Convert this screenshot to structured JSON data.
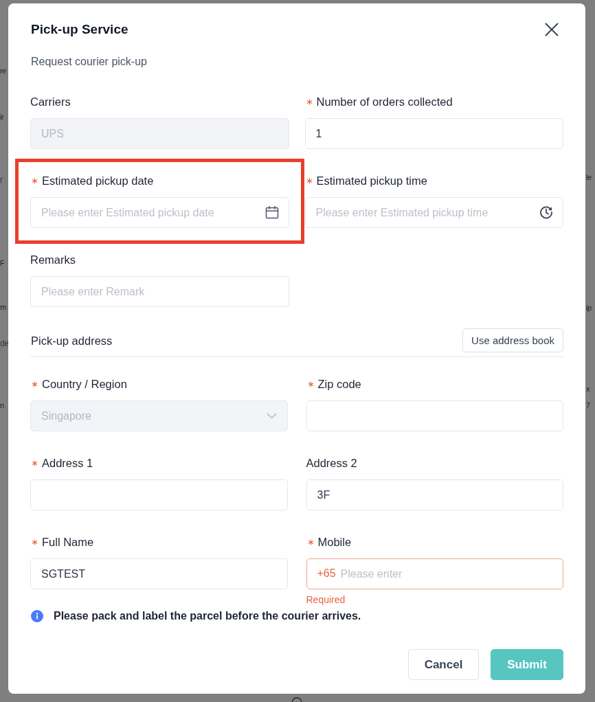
{
  "background_page": {
    "left_edge": [
      {
        "text": "re",
        "kind": "label"
      },
      {
        "text": "ir",
        "kind": "label"
      },
      {
        "text": "r",
        "kind": "hint"
      },
      {
        "text": "F",
        "kind": "label"
      },
      {
        "text": "m",
        "kind": "label"
      },
      {
        "text": "de",
        "kind": "hint"
      },
      {
        "text": "n",
        "kind": "label"
      }
    ],
    "right_edge": [
      {
        "text": "le",
        "kind": "label"
      },
      {
        "text": "ip",
        "kind": "label"
      },
      {
        "text": "x",
        "kind": "label"
      },
      {
        "text": "7",
        "kind": "label"
      }
    ]
  },
  "dialog": {
    "title": "Pick-up Service",
    "subtitle": "Request courier pick-up"
  },
  "fields": [
    {
      "kind": "text",
      "label": "Carriers",
      "required": false,
      "disabled": true,
      "highlighted": false,
      "value": "UPS"
    },
    {
      "kind": "text",
      "label": "Number of orders collected",
      "required": true,
      "disabled": false,
      "highlighted": false,
      "value": "1"
    },
    {
      "kind": "date",
      "label": "Estimated pickup date",
      "required": true,
      "disabled": false,
      "highlighted": true,
      "placeholder": "Please enter Estimated pickup date"
    },
    {
      "kind": "time",
      "label": "Estimated pickup time",
      "required": true,
      "disabled": false,
      "highlighted": false,
      "placeholder": "Please enter Estimated pickup time"
    },
    {
      "kind": "text",
      "label": "Remarks",
      "required": false,
      "disabled": false,
      "highlighted": false,
      "placeholder": "Please enter Remark"
    }
  ],
  "address_section": {
    "title": "Pick-up address",
    "button": "Use address book",
    "fields": [
      {
        "kind": "select",
        "label": "Country / Region",
        "required": true,
        "disabled": true,
        "highlighted": false,
        "value": "Singapore"
      },
      {
        "kind": "text",
        "label": "Zip code",
        "required": true,
        "disabled": false,
        "highlighted": false
      },
      {
        "kind": "text",
        "label": "Address 1",
        "required": true,
        "disabled": false,
        "highlighted": false
      },
      {
        "kind": "text",
        "label": "Address 2",
        "required": false,
        "disabled": false,
        "highlighted": false,
        "value": "3F"
      },
      {
        "kind": "text",
        "label": "Full Name",
        "required": true,
        "disabled": false,
        "highlighted": false,
        "value": "SGTEST"
      },
      {
        "kind": "phone",
        "label": "Mobile",
        "required": true,
        "disabled": false,
        "highlighted": false,
        "prefix": "+65",
        "placeholder": "Please enter",
        "error": "Required"
      }
    ]
  },
  "notice": {
    "text": "Please pack and label the parcel before the courier arrives."
  },
  "buttons": [
    {
      "label": "Cancel",
      "kind": "secondary"
    },
    {
      "label": "Submit",
      "kind": "primary"
    }
  ]
}
